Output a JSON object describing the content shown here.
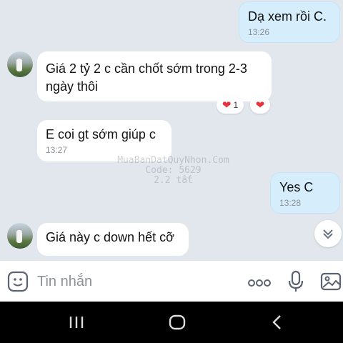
{
  "messages": [
    {
      "text": "Dạ xem rồi C.",
      "time": "13:26"
    },
    {
      "text": "Giá 2 tỷ 2 c cần chốt sớm trong 2-3 ngày thôi",
      "reaction_count": "1"
    },
    {
      "text": "E coi gt sớm giúp c",
      "time": "13:27"
    },
    {
      "text": "Yes C",
      "time": "13:28"
    },
    {
      "text": "Giá này c down hết cỡ"
    }
  ],
  "watermark": {
    "line1": "MuaBanDatQuyNhon.Com",
    "line2": "Code: 5629",
    "line3": "2.2 tất"
  },
  "input": {
    "placeholder": "Tin nhắn"
  },
  "icons": {
    "sticker": "emoji-sticker-icon",
    "more": "more-dots-icon",
    "mic": "microphone-icon",
    "gallery": "image-gallery-icon",
    "scroll": "scroll-down-icon",
    "reaction": "heart-icon",
    "nav_recents": "recent-apps-icon",
    "nav_home": "home-icon",
    "nav_back": "back-icon"
  },
  "colors": {
    "chat_bg": "#e2e7ee",
    "outgoing_bubble": "#d6eefc",
    "incoming_bubble": "#ffffff",
    "heart": "#e8323c"
  }
}
